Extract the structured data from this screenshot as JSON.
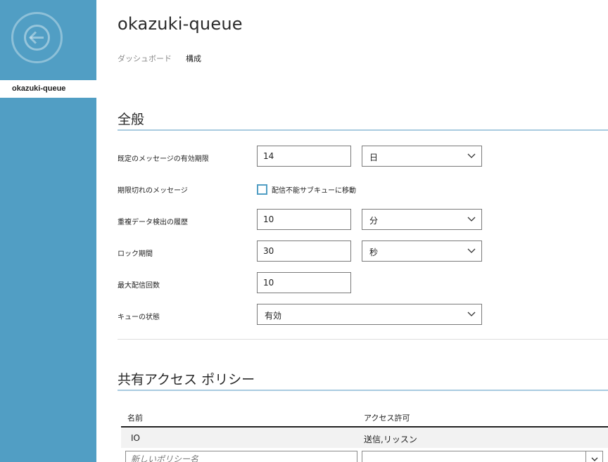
{
  "sidebar": {
    "selected_item": "okazuki-queue"
  },
  "header": {
    "title": "okazuki-queue",
    "tabs": [
      {
        "label": "ダッシュボード",
        "active": false
      },
      {
        "label": "構成",
        "active": true
      }
    ]
  },
  "general": {
    "section_title": "全般",
    "ttl": {
      "label": "既定のメッセージの有効期限",
      "value": "14",
      "unit": "日"
    },
    "expired": {
      "label": "期限切れのメッセージ",
      "checkbox_label": "配信不能サブキューに移動",
      "checked": false
    },
    "duplicate": {
      "label": "重複データ検出の履歴",
      "value": "10",
      "unit": "分"
    },
    "lock": {
      "label": "ロック期間",
      "value": "30",
      "unit": "秒"
    },
    "max_delivery": {
      "label": "最大配信回数",
      "value": "10"
    },
    "queue_state": {
      "label": "キューの状態",
      "value": "有効"
    }
  },
  "shared_access": {
    "section_title": "共有アクセス ポリシー",
    "columns": [
      "名前",
      "アクセス許可"
    ],
    "rows": [
      {
        "name": "IO",
        "permissions": "送信,リッスン"
      }
    ],
    "new_policy_placeholder": "新しいポリシー名"
  },
  "colors": {
    "sidebar": "#519ec4",
    "section_rule": "#a9cbe0",
    "checkbox_border": "#519ec4"
  },
  "icons": {
    "back": "back-arrow-icon",
    "dropdown": "chevron-down-icon"
  }
}
